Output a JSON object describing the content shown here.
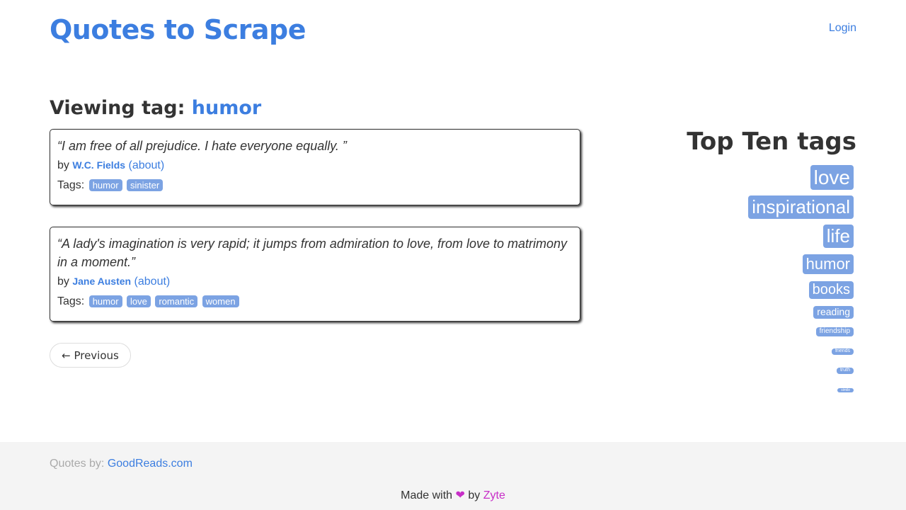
{
  "header": {
    "title": "Quotes to Scrape",
    "login": "Login"
  },
  "viewing": {
    "prefix": "Viewing tag:",
    "tag": "humor"
  },
  "quotes": [
    {
      "text": "“I am free of all prejudice. I hate everyone equally. ”",
      "by": "by",
      "author": "W.C. Fields",
      "about": "(about)",
      "tags_label": "Tags:",
      "tags": [
        "humor",
        "sinister"
      ]
    },
    {
      "text": "“A lady's imagination is very rapid; it jumps from admiration to love, from love to matrimony in a moment.”",
      "by": "by",
      "author": "Jane Austen",
      "about": "(about)",
      "tags_label": "Tags:",
      "tags": [
        "humor",
        "love",
        "romantic",
        "women"
      ]
    }
  ],
  "pager": {
    "previous": "← Previous"
  },
  "top_tags": {
    "heading": "Top Ten tags",
    "tags": [
      "love",
      "inspirational",
      "life",
      "humor",
      "books",
      "reading",
      "friendship",
      "friends",
      "truth",
      "simile"
    ]
  },
  "footer": {
    "source_prefix": "Quotes by:",
    "source_link": "GoodReads.com",
    "made_prefix": "Made with",
    "heart": "❤",
    "made_by": "by",
    "made_link": "Zyte"
  },
  "colors": {
    "accent": "#3c7ee0",
    "tag_bg": "#7ca3e3",
    "footer_bg": "#f4f4f4",
    "heart": "#c72ec7"
  }
}
